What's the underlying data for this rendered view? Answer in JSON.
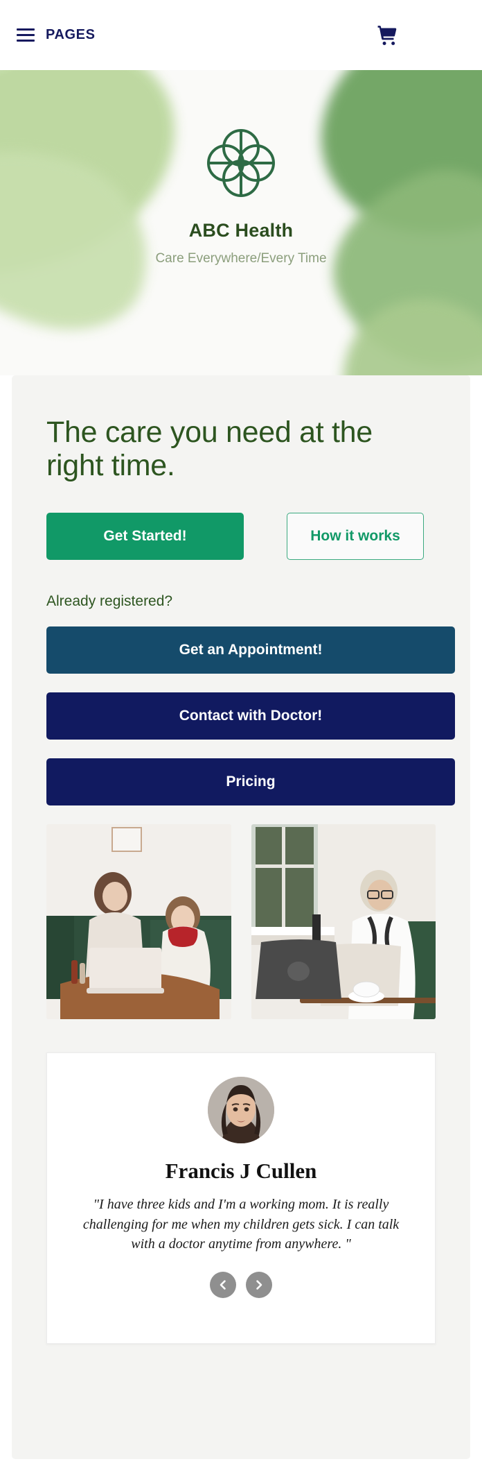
{
  "header": {
    "menu_label": "PAGES",
    "menu_icon": "hamburger-menu-icon",
    "cart_icon": "shopping-cart-icon"
  },
  "hero": {
    "logo_icon": "quatrefoil-logo-icon",
    "brand_name": "ABC Health",
    "tagline": "Care Everywhere/Every Time"
  },
  "main": {
    "headline": "The care you need at the right time.",
    "cta": {
      "primary_label": "Get Started!",
      "outline_label": "How it works"
    },
    "already_registered_label": "Already registered?",
    "actions": [
      {
        "label": "Get an Appointment!",
        "color": "#154b6b"
      },
      {
        "label": "Contact with Doctor!",
        "color": "#111a60"
      },
      {
        "label": "Pricing",
        "color": "#111a60"
      }
    ],
    "photos": [
      {
        "alt": "mother-and-sick-child-video-consult-photo"
      },
      {
        "alt": "female-doctor-at-laptop-photo"
      }
    ]
  },
  "testimonial": {
    "avatar_alt": "patient-avatar",
    "name": "Francis J Cullen",
    "quote": "\"I have three kids and I'm a working mom. It is really challenging for me when my children gets sick. I can talk with a doctor anytime from anywhere. \"",
    "prev_icon": "chevron-left-icon",
    "next_icon": "chevron-right-icon"
  },
  "colors": {
    "brand_green": "#2b4d1f",
    "accent_green": "#119967",
    "navy": "#111a60",
    "teal": "#154b6b",
    "panel_bg": "#f4f4f2",
    "sage": "#8b9e7c"
  }
}
